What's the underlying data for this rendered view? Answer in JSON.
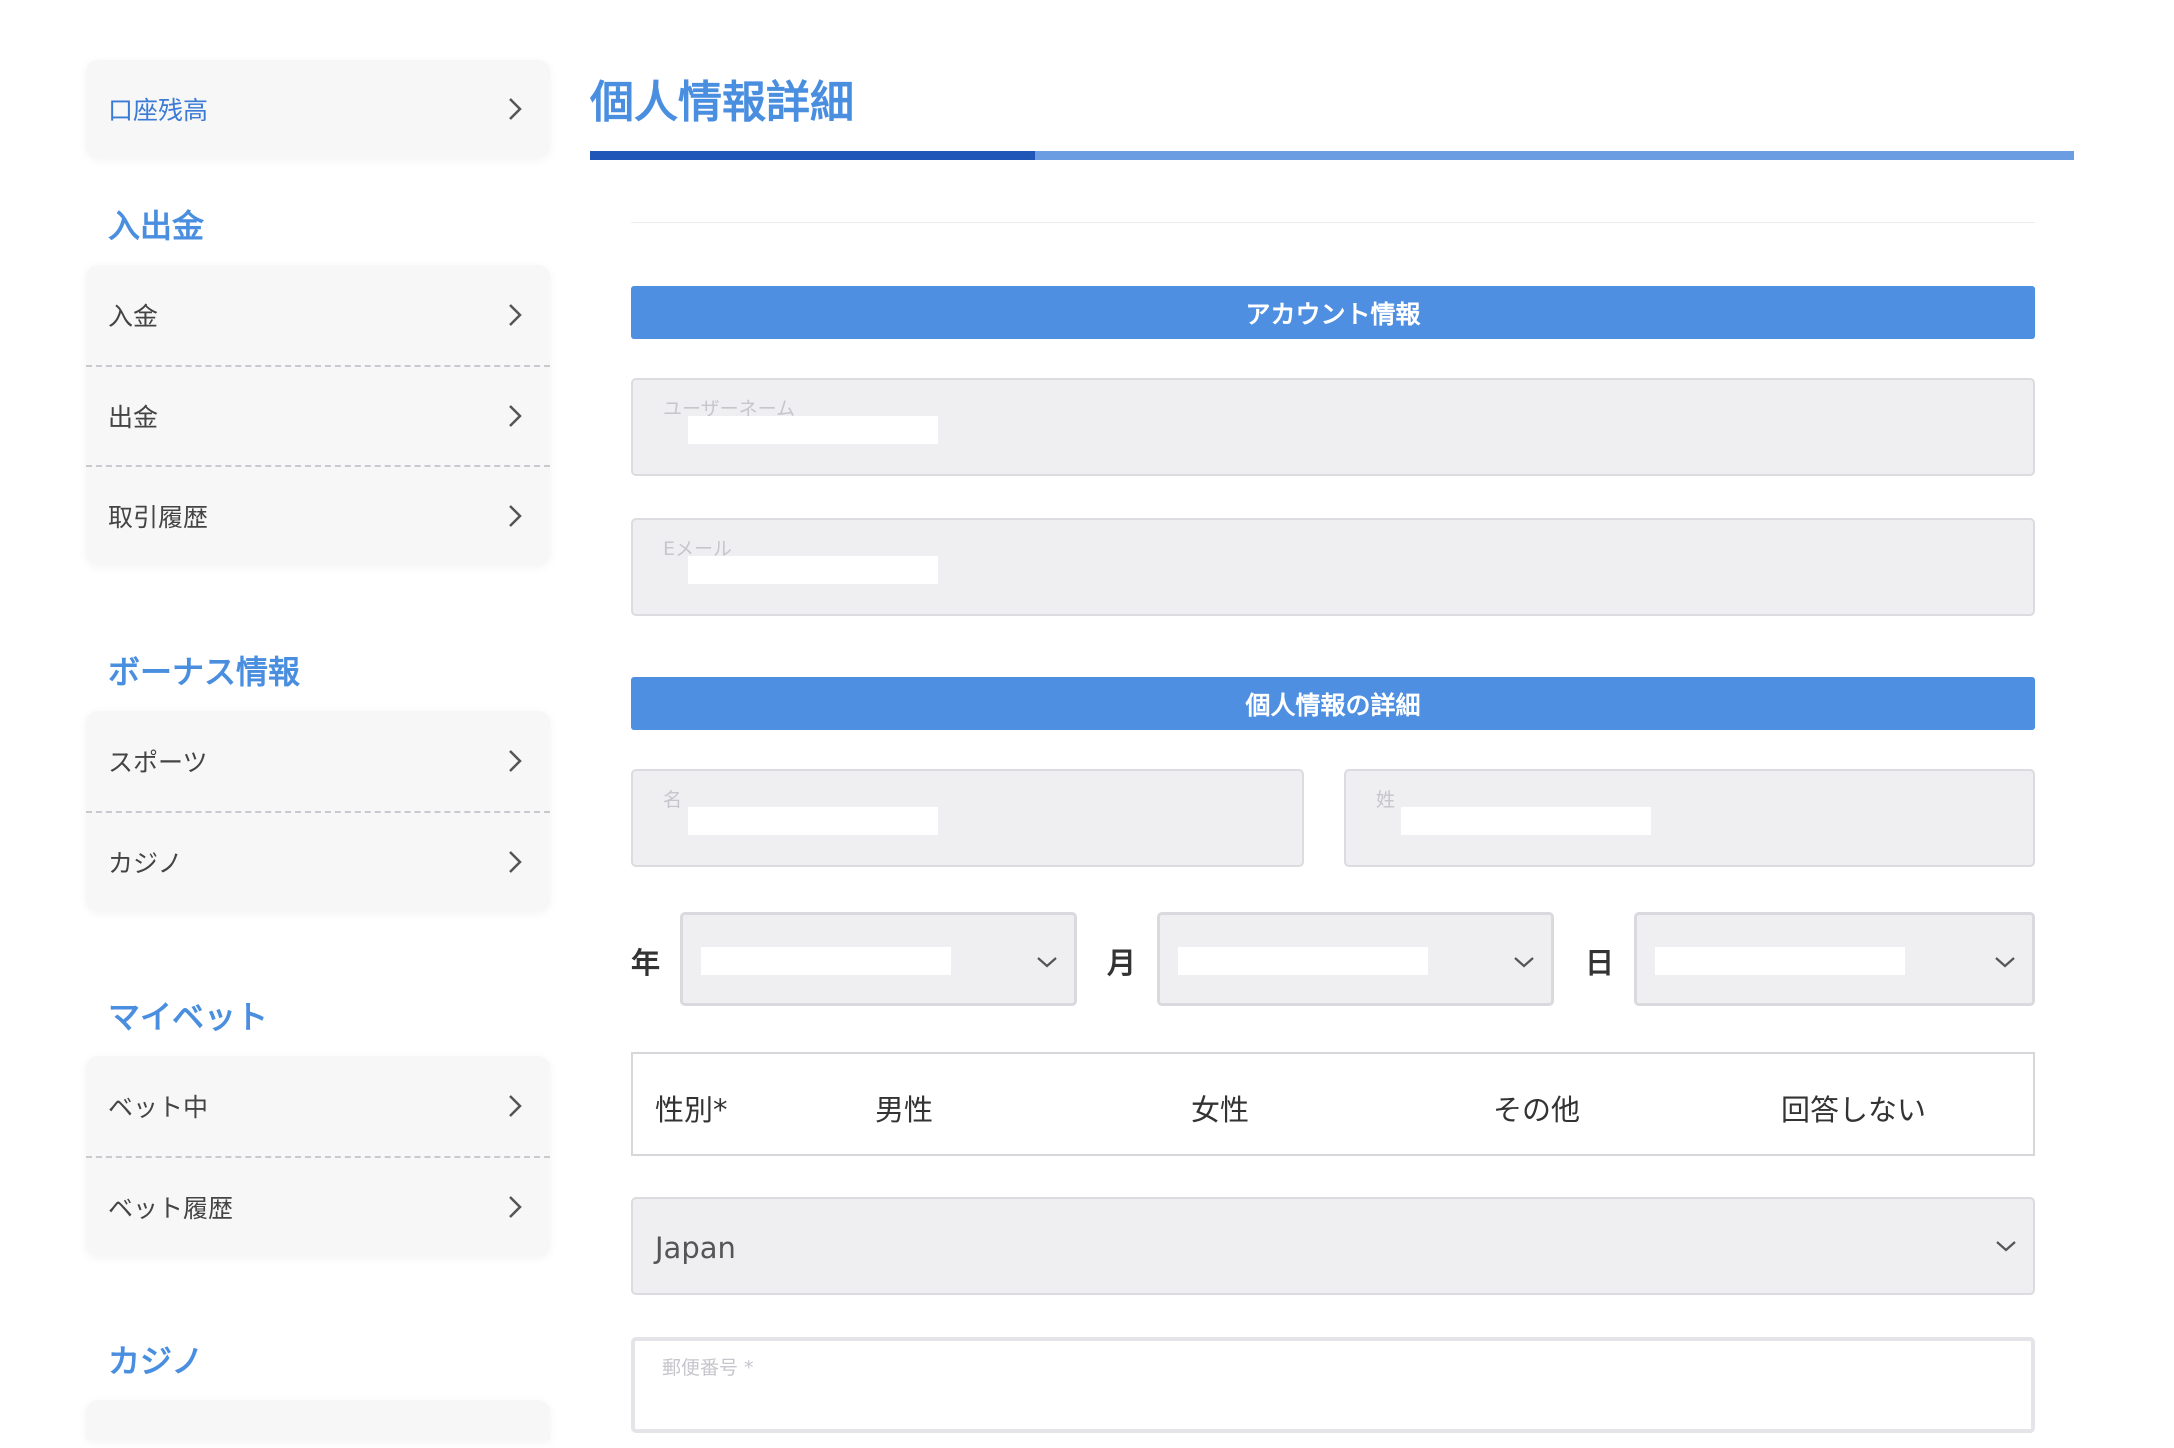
{
  "sidebar": {
    "balance_label": "口座残高",
    "sections": [
      {
        "heading": "入出金",
        "items": [
          "入金",
          "出金",
          "取引履歴"
        ]
      },
      {
        "heading": "ボーナス情報",
        "items": [
          "スポーツ",
          "カジノ"
        ]
      },
      {
        "heading": "マイベット",
        "items": [
          "ベット中",
          "ベット履歴"
        ]
      },
      {
        "heading": "カジノ",
        "items": []
      }
    ]
  },
  "main": {
    "title": "個人情報詳細",
    "progress": 0.3,
    "account_section": "アカウント情報",
    "username_placeholder": "ユーザーネーム",
    "email_placeholder": "Eメール",
    "personal_section": "個人情報の詳細",
    "first_name_placeholder": "名",
    "last_name_placeholder": "姓",
    "year_label": "年",
    "month_label": "月",
    "day_label": "日",
    "gender": {
      "label": "性別*",
      "options": [
        "男性",
        "女性",
        "その他",
        "回答しない"
      ]
    },
    "country": "Japan",
    "postal_placeholder": "郵便番号 *"
  },
  "colors": {
    "accent": "#4a8ee0",
    "section_bar": "#4f8fe2",
    "progress_fill": "#1f56b8"
  },
  "icons": {
    "chevron": "chevron-right-icon",
    "dropdown": "chevron-down-icon"
  }
}
